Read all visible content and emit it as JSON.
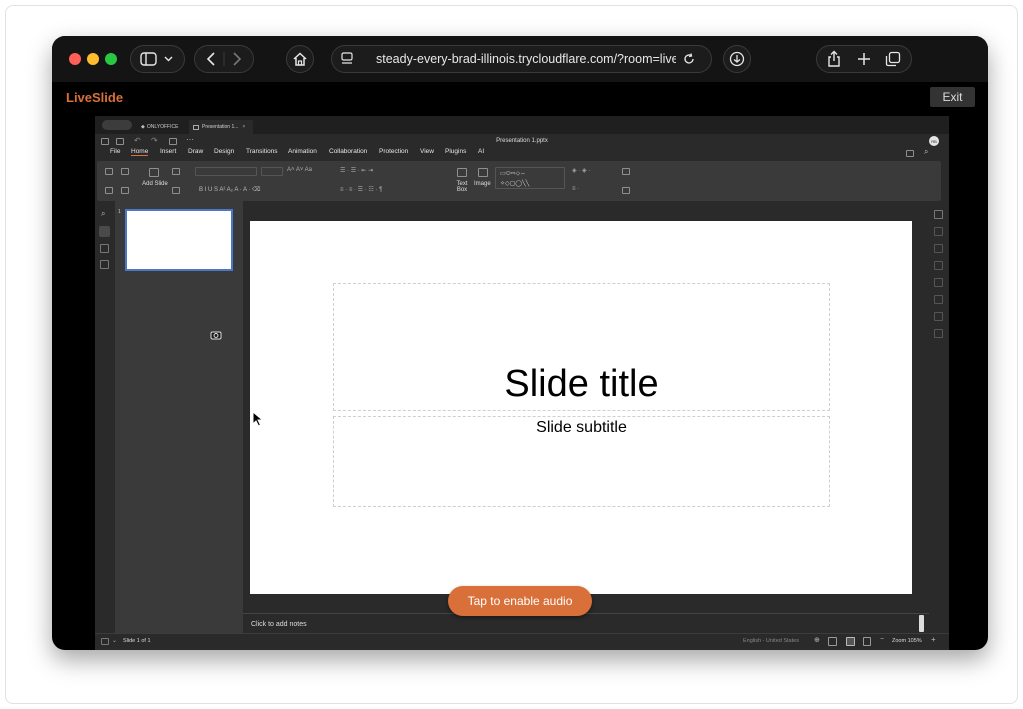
{
  "browser": {
    "url": "steady-every-brad-illinois.trycloudflare.com/?room=liveslide-",
    "traffic_colors": [
      "#ff5f57",
      "#febc2e",
      "#28c840"
    ]
  },
  "app": {
    "brand": "LiveSlide",
    "exit_label": "Exit",
    "audio_button": "Tap to enable audio",
    "accent": "#d9703a"
  },
  "editor": {
    "tabs": [
      "ONLYOFFICE",
      "Presentation 1..."
    ],
    "doc_title": "Presentation 1.pptx",
    "avatar_initials": "RB",
    "menu": [
      "File",
      "Home",
      "Insert",
      "Draw",
      "Design",
      "Transitions",
      "Animation",
      "Collaboration",
      "Protection",
      "View",
      "Plugins",
      "AI"
    ],
    "active_menu": "Home",
    "ribbon": {
      "add_slide": "Add Slide",
      "text_box": "Text Box",
      "image": "Image"
    },
    "slide_number": "1",
    "slide_title": "Slide title",
    "slide_subtitle": "Slide subtitle",
    "notes_placeholder": "Click to add notes",
    "status": {
      "slide_counter": "Slide 1 of 1",
      "language": "English - United States",
      "zoom": "Zoom 105%"
    }
  }
}
